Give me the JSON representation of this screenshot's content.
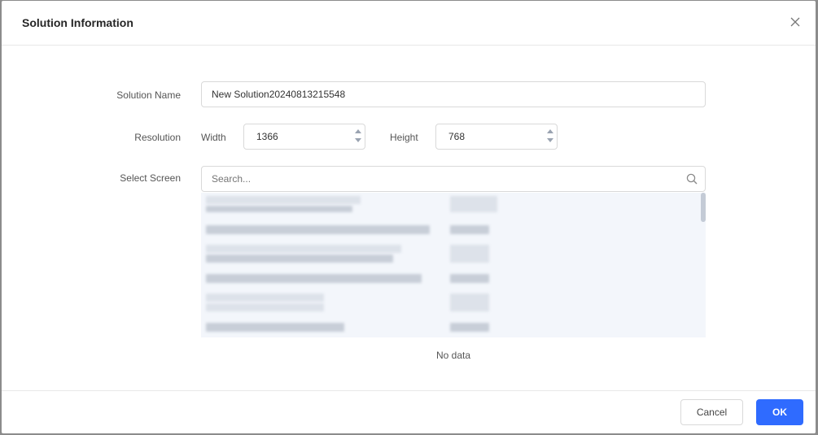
{
  "dialog": {
    "title": "Solution Information",
    "close_icon": "close-icon"
  },
  "form": {
    "solution_name_label": "Solution Name",
    "solution_name_value": "New Solution20240813215548",
    "resolution_label": "Resolution",
    "width_label": "Width",
    "width_value": "1366",
    "height_label": "Height",
    "height_value": "768",
    "select_screen_label": "Select Screen",
    "search_placeholder": "Search...",
    "search_icon": "search-icon",
    "no_data": "No data"
  },
  "footer": {
    "cancel_label": "Cancel",
    "ok_label": "OK"
  },
  "colors": {
    "primary": "#2f6bff",
    "list_background": "#f3f6fb"
  }
}
